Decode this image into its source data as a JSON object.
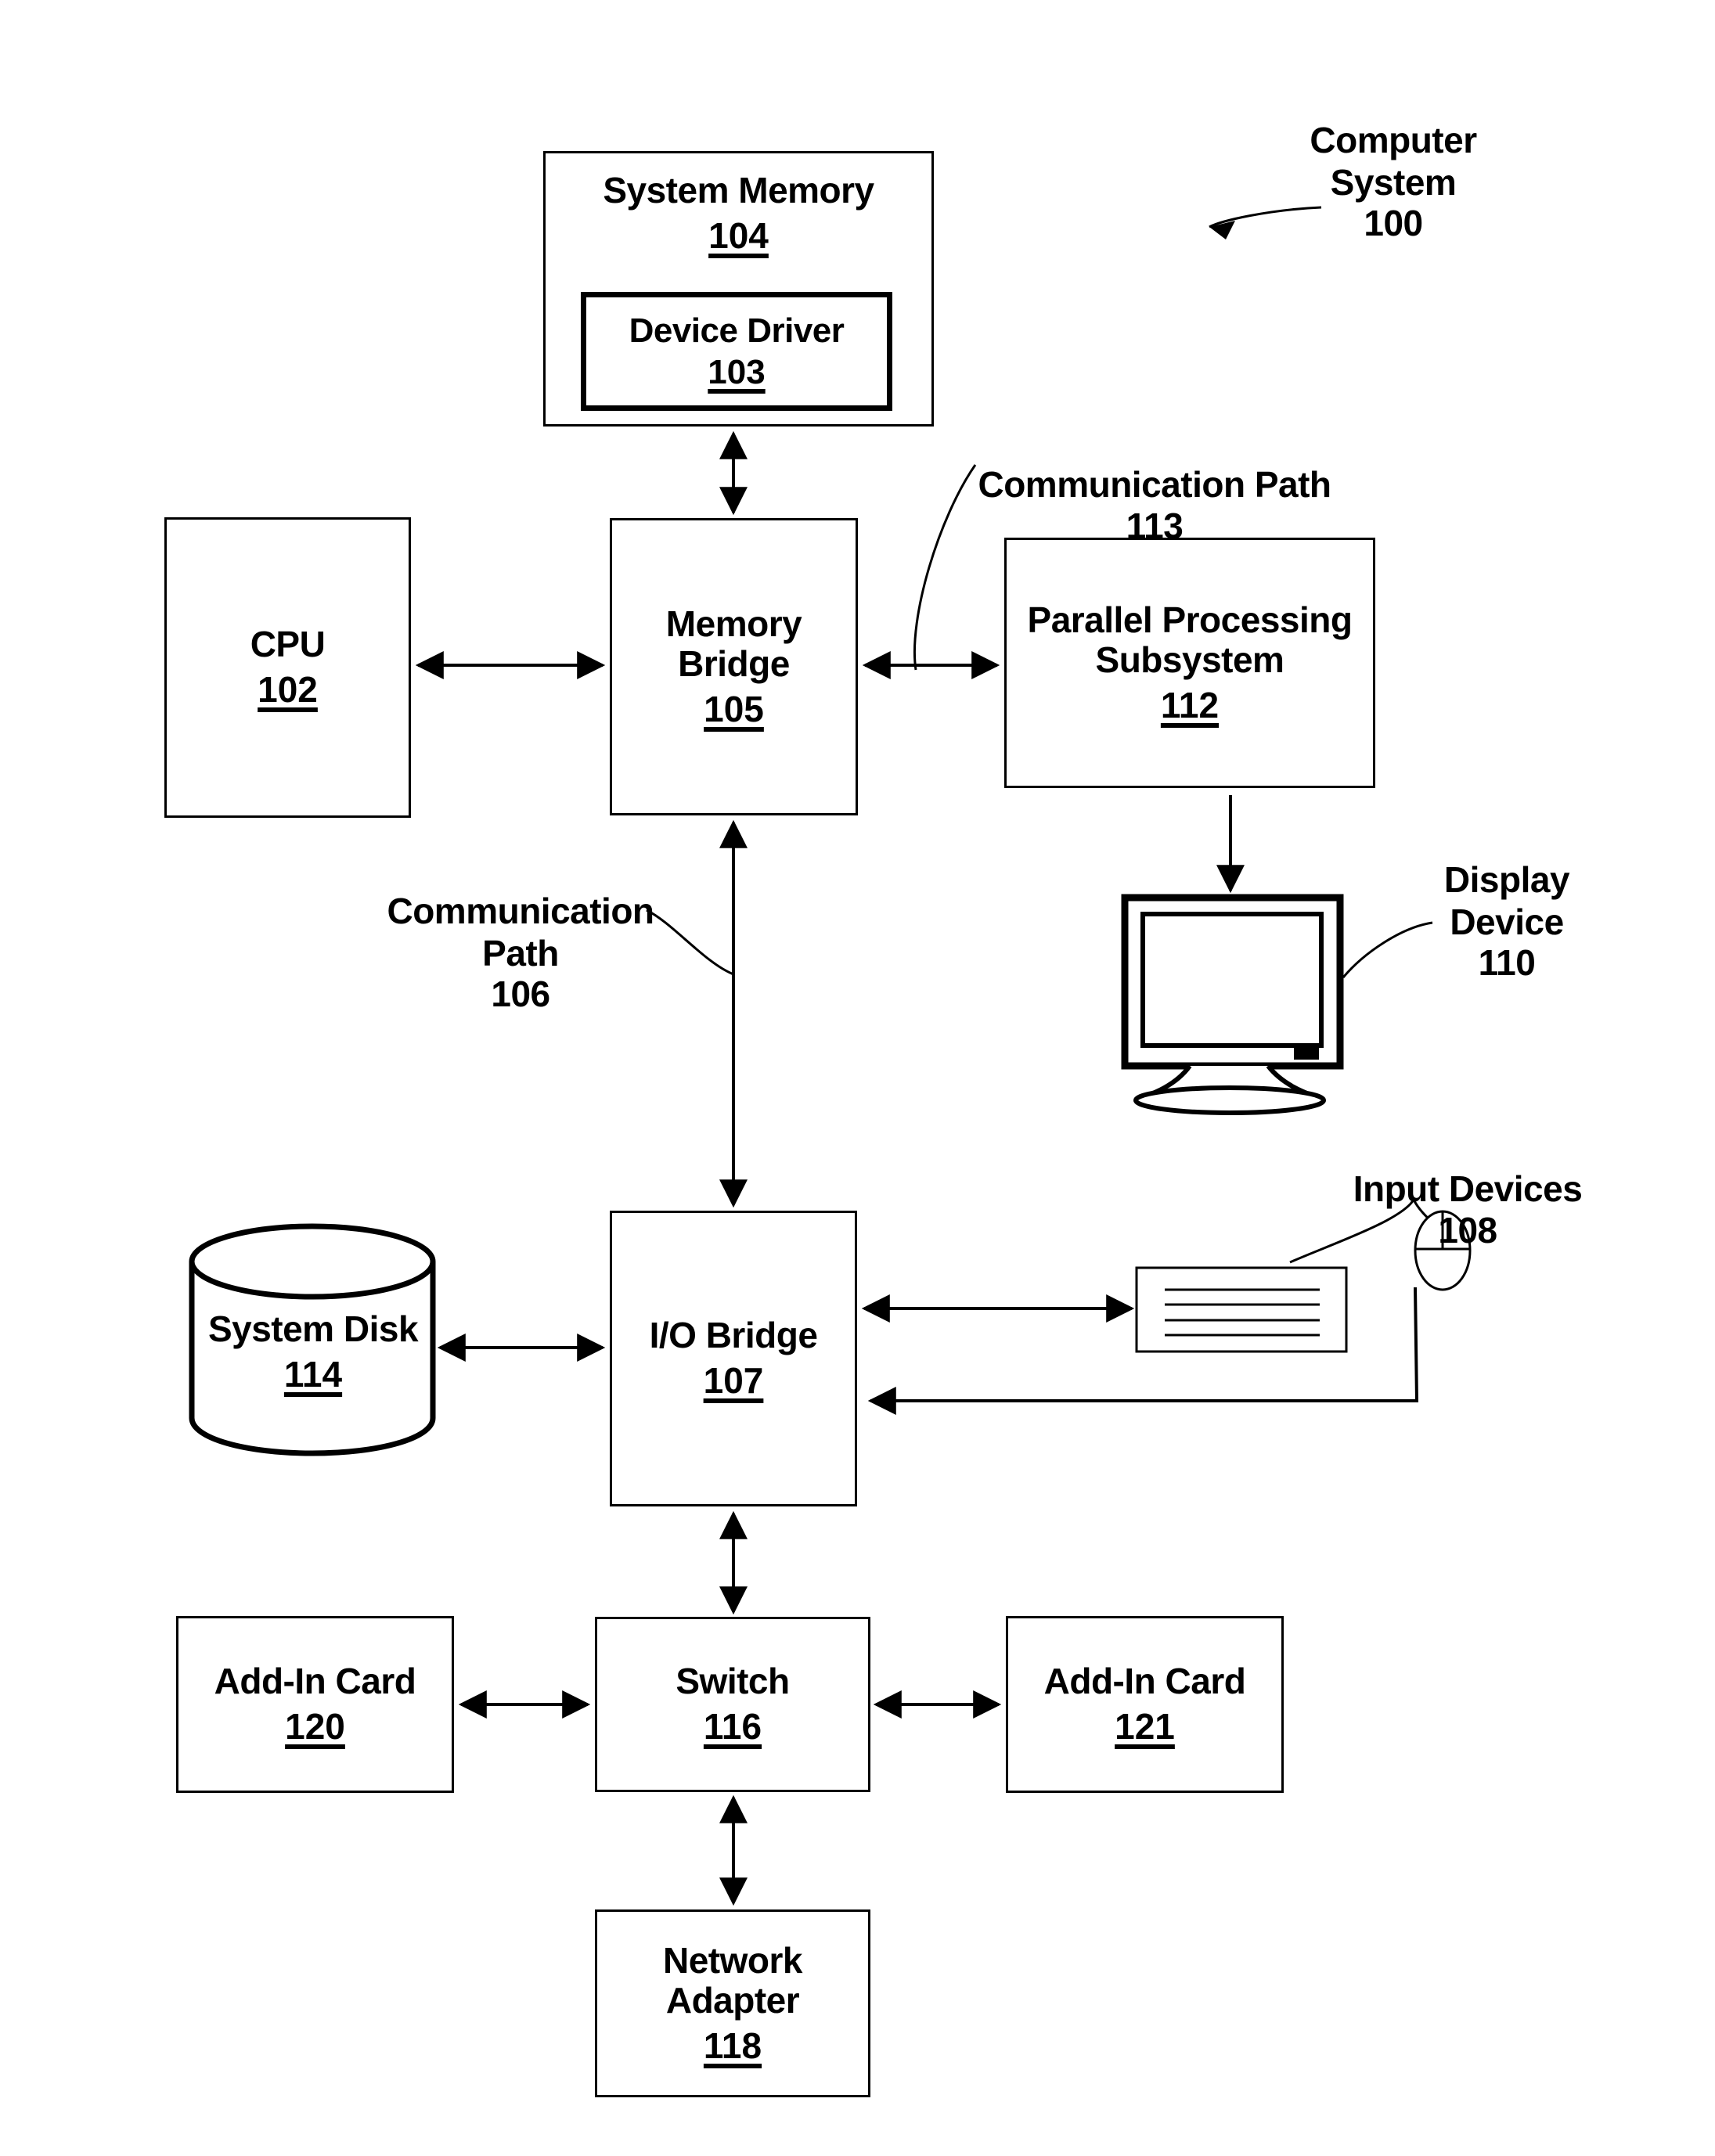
{
  "figure": {
    "title_label": "Computer System",
    "title_number": "100",
    "type": "block-diagram"
  },
  "blocks": {
    "system_memory": {
      "title": "System Memory",
      "number": "104"
    },
    "device_driver": {
      "title": "Device Driver",
      "number": "103"
    },
    "cpu": {
      "title": "CPU",
      "number": "102"
    },
    "memory_bridge": {
      "title": "Memory\nBridge",
      "number": "105"
    },
    "pps": {
      "title": "Parallel Processing\nSubsystem",
      "number": "112"
    },
    "io_bridge": {
      "title": "I/O Bridge",
      "number": "107"
    },
    "system_disk": {
      "title": "System\nDisk",
      "number": "114"
    },
    "switch": {
      "title": "Switch",
      "number": "116"
    },
    "add_in_card_120": {
      "title": "Add-In Card",
      "number": "120"
    },
    "add_in_card_121": {
      "title": "Add-In Card",
      "number": "121"
    },
    "network_adapter": {
      "title": "Network\nAdapter",
      "number": "118"
    }
  },
  "callouts": {
    "comm_path_113": {
      "text": "Communication Path",
      "number": "113"
    },
    "comm_path_106": {
      "text": "Communication\nPath",
      "number": "106"
    },
    "display_device": {
      "text": "Display\nDevice",
      "number": "110"
    },
    "input_devices": {
      "text": "Input Devices",
      "number": "108"
    }
  },
  "icons": {
    "display": "monitor-icon",
    "keyboard": "keyboard-icon",
    "mouse": "mouse-icon",
    "disk": "cylinder-disk-icon"
  },
  "colors": {
    "stroke": "#000000",
    "fill": "#ffffff"
  }
}
